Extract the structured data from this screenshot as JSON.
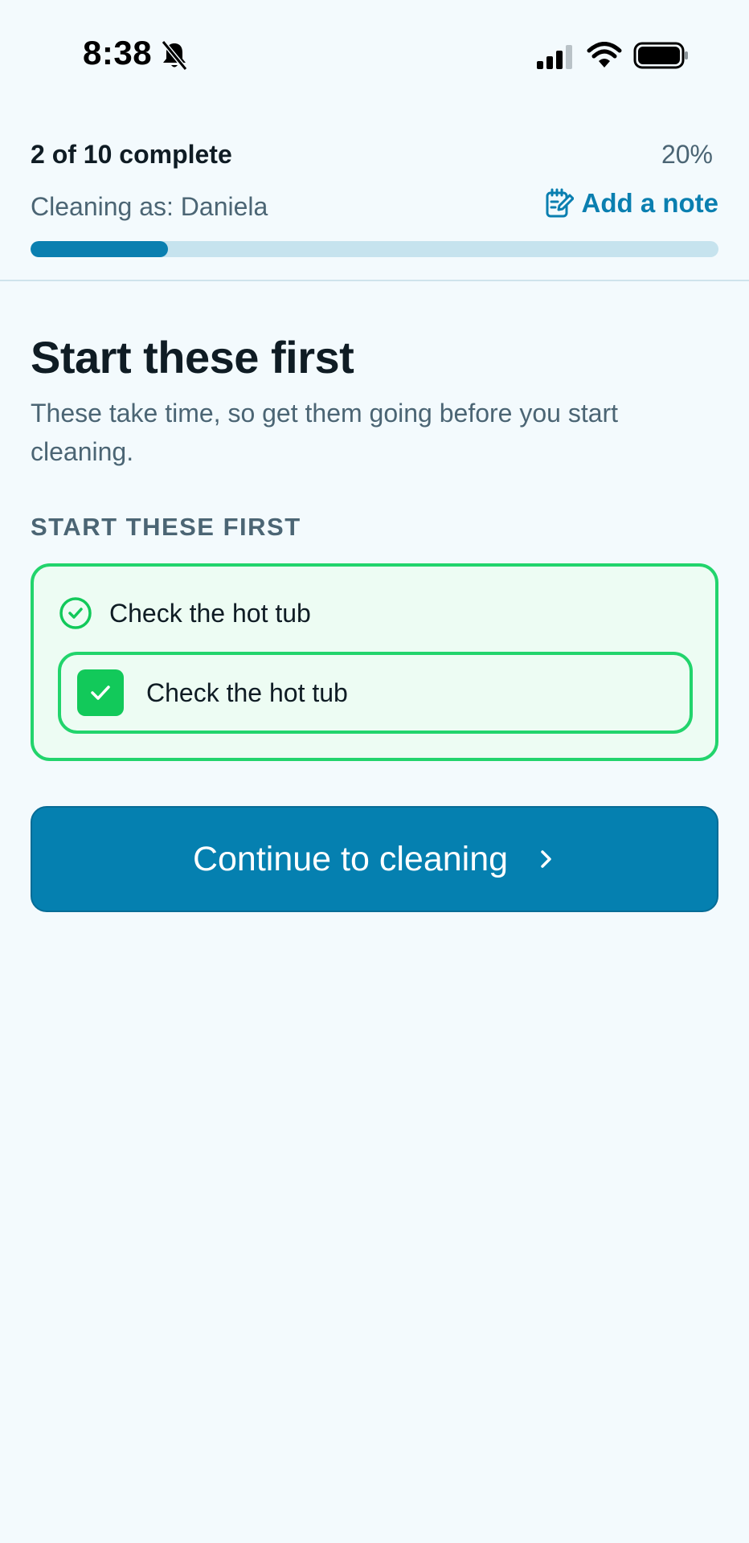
{
  "status_bar": {
    "time": "8:38",
    "icons": [
      "bell-slash-icon",
      "signal-icon",
      "wifi-icon",
      "battery-icon"
    ]
  },
  "progress": {
    "count_text": "2 of 10 complete",
    "percent_text": "20%",
    "fraction": 0.2,
    "cleaning_as": "Cleaning as: Daniela",
    "add_note_label": "Add a note"
  },
  "main": {
    "title": "Start these first",
    "subtitle": "These take time, so get them going before you start cleaning.",
    "section_label": "START THESE FIRST",
    "task": {
      "title": "Check the hot tub",
      "subtask_label": "Check the hot tub",
      "checked": true
    },
    "continue_label": "Continue to cleaning"
  },
  "colors": {
    "accent": "#0580b0",
    "success": "#22d46c",
    "background": "#f3fafd"
  }
}
